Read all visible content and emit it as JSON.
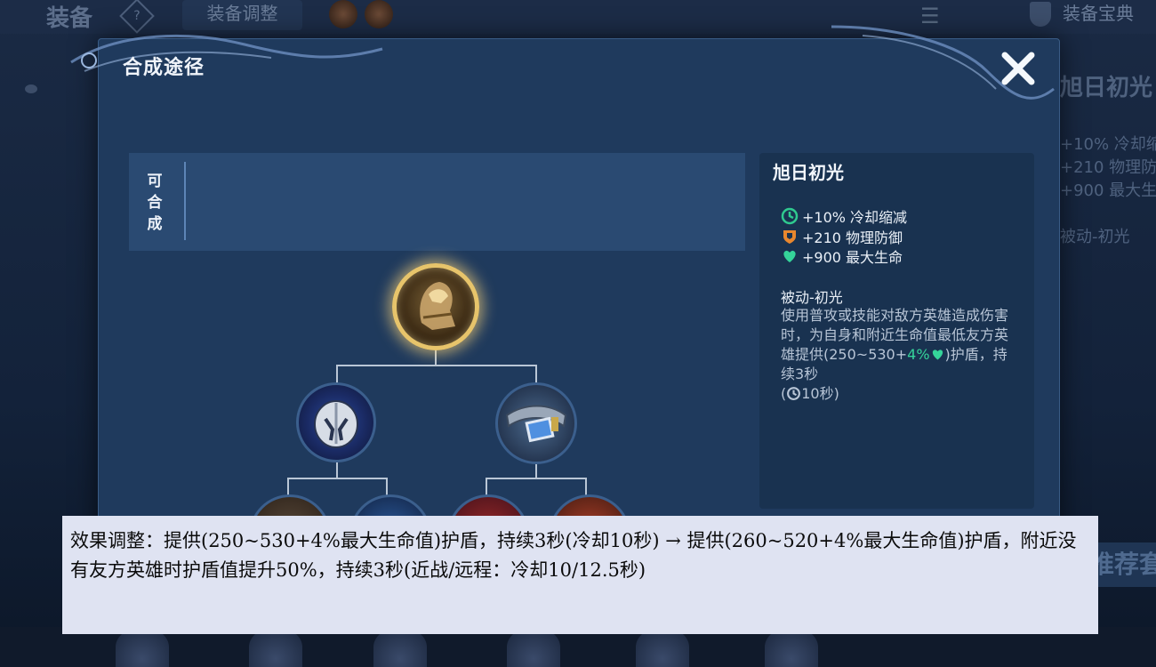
{
  "background": {
    "top_title": "装备",
    "top_help": "?",
    "top_tab": "装备调整",
    "top_menu": "☰",
    "top_guide": "装备宝典",
    "right_title": "旭日初光",
    "right_lines": [
      "+10% 冷却缩",
      "+210 物理防御",
      "+900 最大生"
    ],
    "right_passive": "被动-初光",
    "right_recommend": "推荐套"
  },
  "modal": {
    "title": "合成途径",
    "close_label": "✕",
    "composable_label": "可合成",
    "tree": {
      "main_item": "旭日初光",
      "components": [
        "component-helmet",
        "component-belt"
      ],
      "sub_components": [
        "sub-1",
        "sub-2",
        "sub-3",
        "sub-4"
      ]
    },
    "info": {
      "name": "旭日初光",
      "stats": [
        {
          "icon": "cooldown-icon",
          "text": "+10% 冷却缩减",
          "color": "#2fc98f"
        },
        {
          "icon": "armor-icon",
          "text": "+210 物理防御",
          "color": "#e8872e"
        },
        {
          "icon": "health-icon",
          "text": "+900 最大生命",
          "color": "#35d49a"
        }
      ],
      "passive_title": "被动-初光",
      "passive_desc_1": "使用普攻或技能对敌方英雄造成伤害时，为自身和附近生命值最低友方英雄提供(250~530+",
      "passive_desc_pct": "4%",
      "passive_desc_2": ")护盾，持续3秒",
      "passive_cd_prefix": "(",
      "passive_cd": "10秒)"
    }
  },
  "caption": {
    "text": "效果调整：提供(250~530+4%最大生命值)护盾，持续3秒(冷却10秒) → 提供(260~520+4%最大生命值)护盾，附近没有友方英雄时护盾值提升50%，持续3秒(近战/远程：冷却10/12.5秒)"
  },
  "colors": {
    "modal_bg": "#1f3a5d",
    "accent_gold": "#e7c46b",
    "stat_green": "#35d49a",
    "stat_orange": "#e8872e",
    "caption_bg": "#dfe3f2"
  }
}
